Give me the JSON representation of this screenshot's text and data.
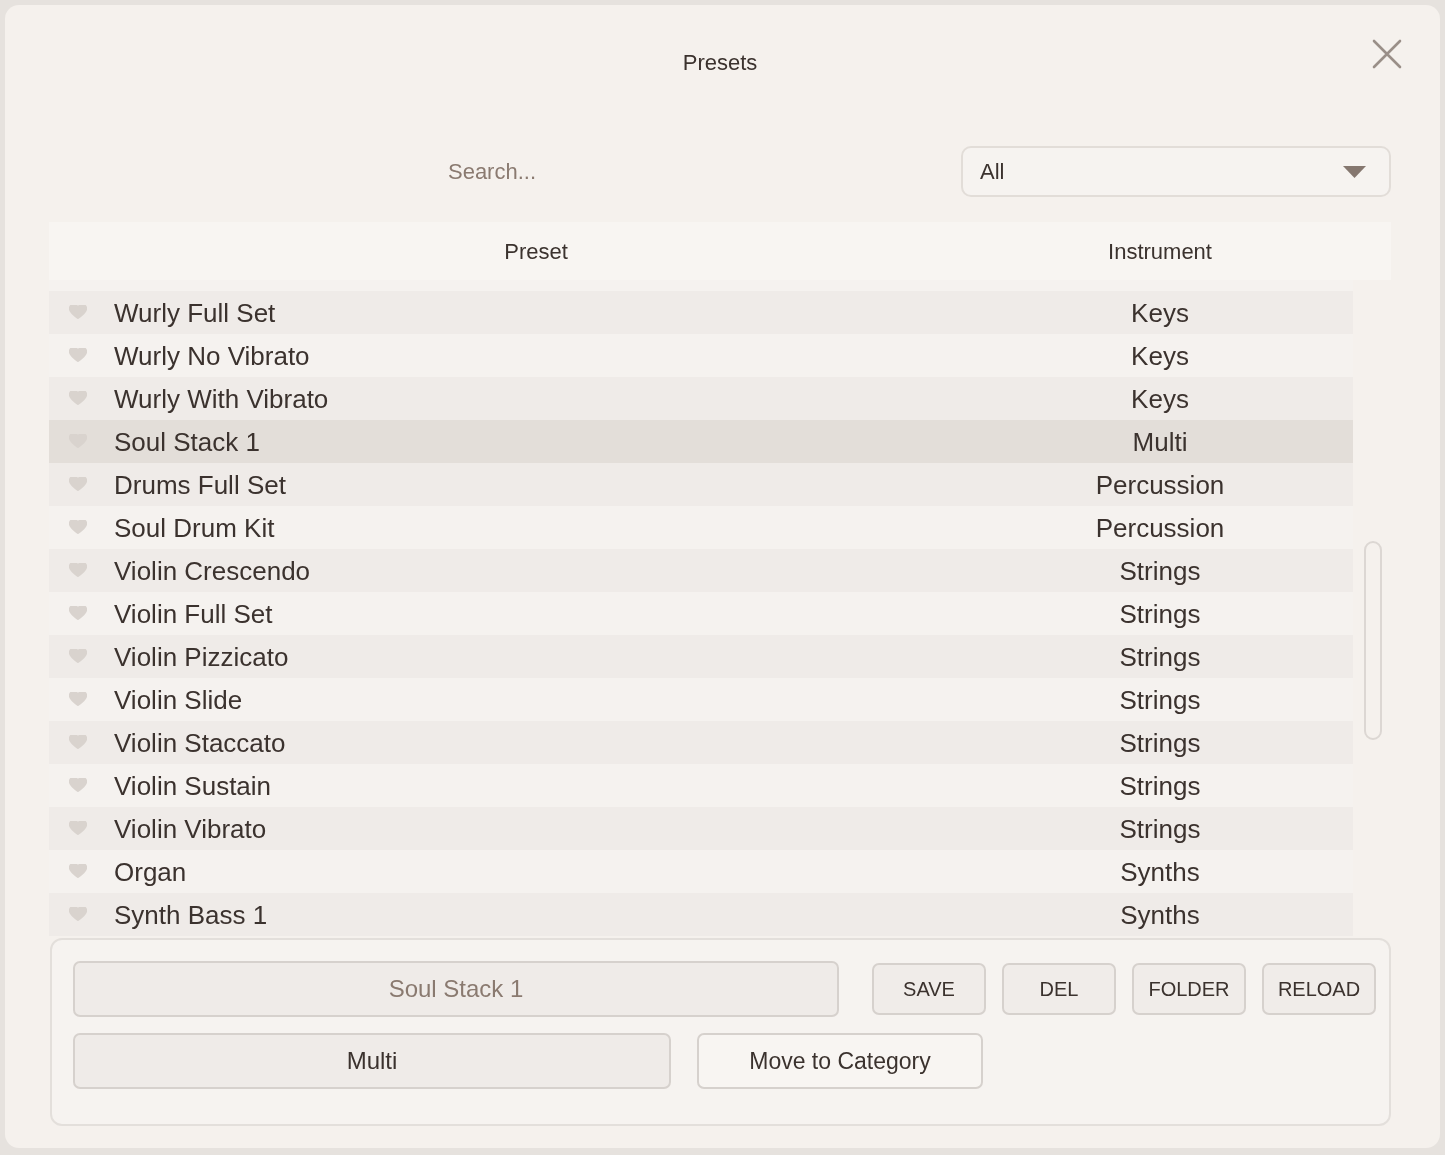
{
  "dialog": {
    "title": "Presets"
  },
  "search": {
    "placeholder": "Search..."
  },
  "category_filter": {
    "value": "All"
  },
  "table": {
    "columns": [
      "Preset",
      "Instrument"
    ],
    "rows": [
      {
        "name": "Wurly Full Set",
        "instrument": "Keys",
        "favorite": false,
        "selected": false
      },
      {
        "name": "Wurly No Vibrato",
        "instrument": "Keys",
        "favorite": false,
        "selected": false
      },
      {
        "name": "Wurly With Vibrato",
        "instrument": "Keys",
        "favorite": false,
        "selected": false
      },
      {
        "name": "Soul Stack 1",
        "instrument": "Multi",
        "favorite": false,
        "selected": true
      },
      {
        "name": "Drums Full Set",
        "instrument": "Percussion",
        "favorite": false,
        "selected": false
      },
      {
        "name": "Soul Drum Kit",
        "instrument": "Percussion",
        "favorite": false,
        "selected": false
      },
      {
        "name": "Violin Crescendo",
        "instrument": "Strings",
        "favorite": false,
        "selected": false
      },
      {
        "name": "Violin Full Set",
        "instrument": "Strings",
        "favorite": false,
        "selected": false
      },
      {
        "name": "Violin Pizzicato",
        "instrument": "Strings",
        "favorite": false,
        "selected": false
      },
      {
        "name": "Violin Slide",
        "instrument": "Strings",
        "favorite": false,
        "selected": false
      },
      {
        "name": "Violin Staccato",
        "instrument": "Strings",
        "favorite": false,
        "selected": false
      },
      {
        "name": "Violin Sustain",
        "instrument": "Strings",
        "favorite": false,
        "selected": false
      },
      {
        "name": "Violin Vibrato",
        "instrument": "Strings",
        "favorite": false,
        "selected": false
      },
      {
        "name": "Organ",
        "instrument": "Synths",
        "favorite": false,
        "selected": false
      },
      {
        "name": "Synth Bass 1",
        "instrument": "Synths",
        "favorite": false,
        "selected": false
      }
    ]
  },
  "editor": {
    "name_field": {
      "value": "Soul Stack 1"
    },
    "buttons": [
      "SAVE",
      "DEL",
      "FOLDER",
      "RELOAD"
    ],
    "category_field": {
      "value": "Multi"
    },
    "move_button": "Move to Category"
  }
}
